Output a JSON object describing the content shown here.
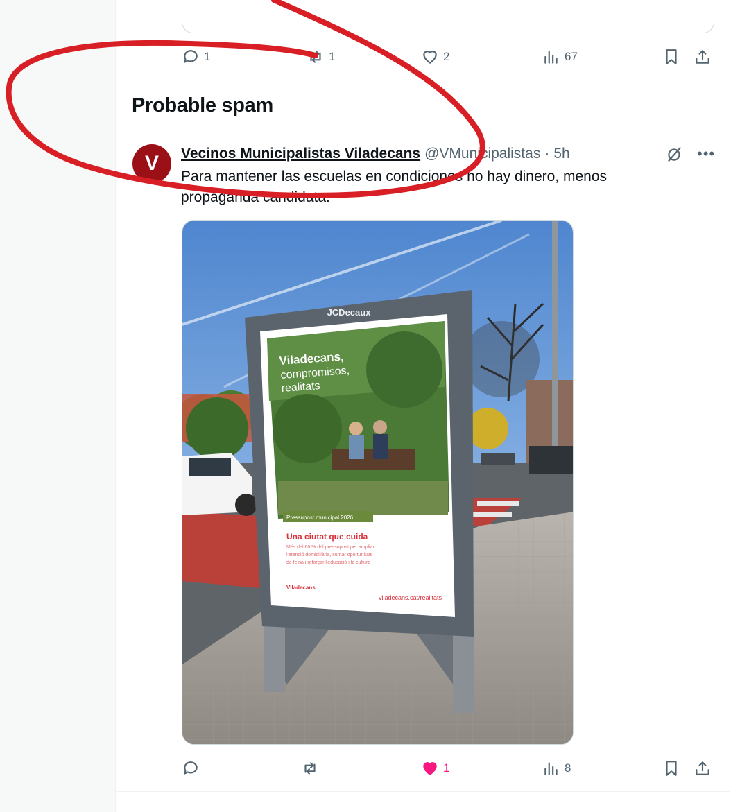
{
  "previous_tweet": {
    "actions": {
      "reply_count": "1",
      "repost_count": "1",
      "like_count": "2",
      "views_count": "67"
    }
  },
  "section": {
    "title": "Probable spam"
  },
  "tweet": {
    "avatar_letter": "V",
    "author_name": "Vecinos Municipalistas Viladecans",
    "author_handle": "@VMunicipalistas",
    "separator": "·",
    "time": "5h",
    "text": "Para mantener las escuelas en condiciones no hay dinero, menos propaganda candidata.",
    "media": {
      "board_brand": "JCDecaux",
      "poster_title_line1": "Viladecans,",
      "poster_title_line2": "compromisos,",
      "poster_title_line3": "realitats",
      "poster_tag": "Pressupost municipal 2026",
      "poster_headline": "Una ciutat que cuida",
      "poster_body_line1": "Més del 60 % del pressupost per ampliar",
      "poster_body_line2": "l'atenció domiciliària, sumar oportunitats",
      "poster_body_line3": "de feina i reforçar l'educació i la cultura",
      "poster_logo": "Viladecans",
      "poster_url": "viladecans.cat/realitats"
    },
    "actions": {
      "reply_count": "",
      "repost_count": "",
      "like_count": "1",
      "views_count": "8"
    }
  },
  "colors": {
    "annotation_red": "#d81f26",
    "like_pink": "#f91880",
    "avatar_red": "#9b1016"
  }
}
